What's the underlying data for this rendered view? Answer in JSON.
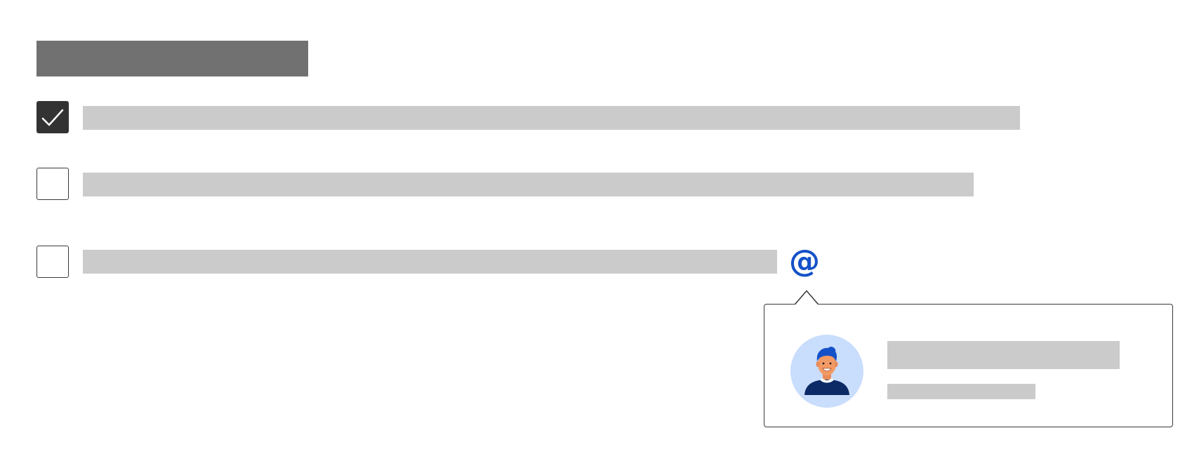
{
  "page": {
    "title": "",
    "background": "#ffffff"
  },
  "checklist": {
    "items": [
      {
        "checked": true,
        "label": ""
      },
      {
        "checked": false,
        "label": ""
      },
      {
        "checked": false,
        "label": ""
      }
    ]
  },
  "mention": {
    "trigger_symbol": "@",
    "color": "#1451c8",
    "popover": {
      "user_name": "",
      "user_detail": "",
      "avatar": "person-avatar-icon"
    }
  },
  "colors": {
    "title_placeholder": "#717171",
    "text_placeholder": "#cbcbcb",
    "checkbox_checked": "#333333",
    "avatar_background": "#c9ddfc",
    "accent": "#1451c8"
  }
}
